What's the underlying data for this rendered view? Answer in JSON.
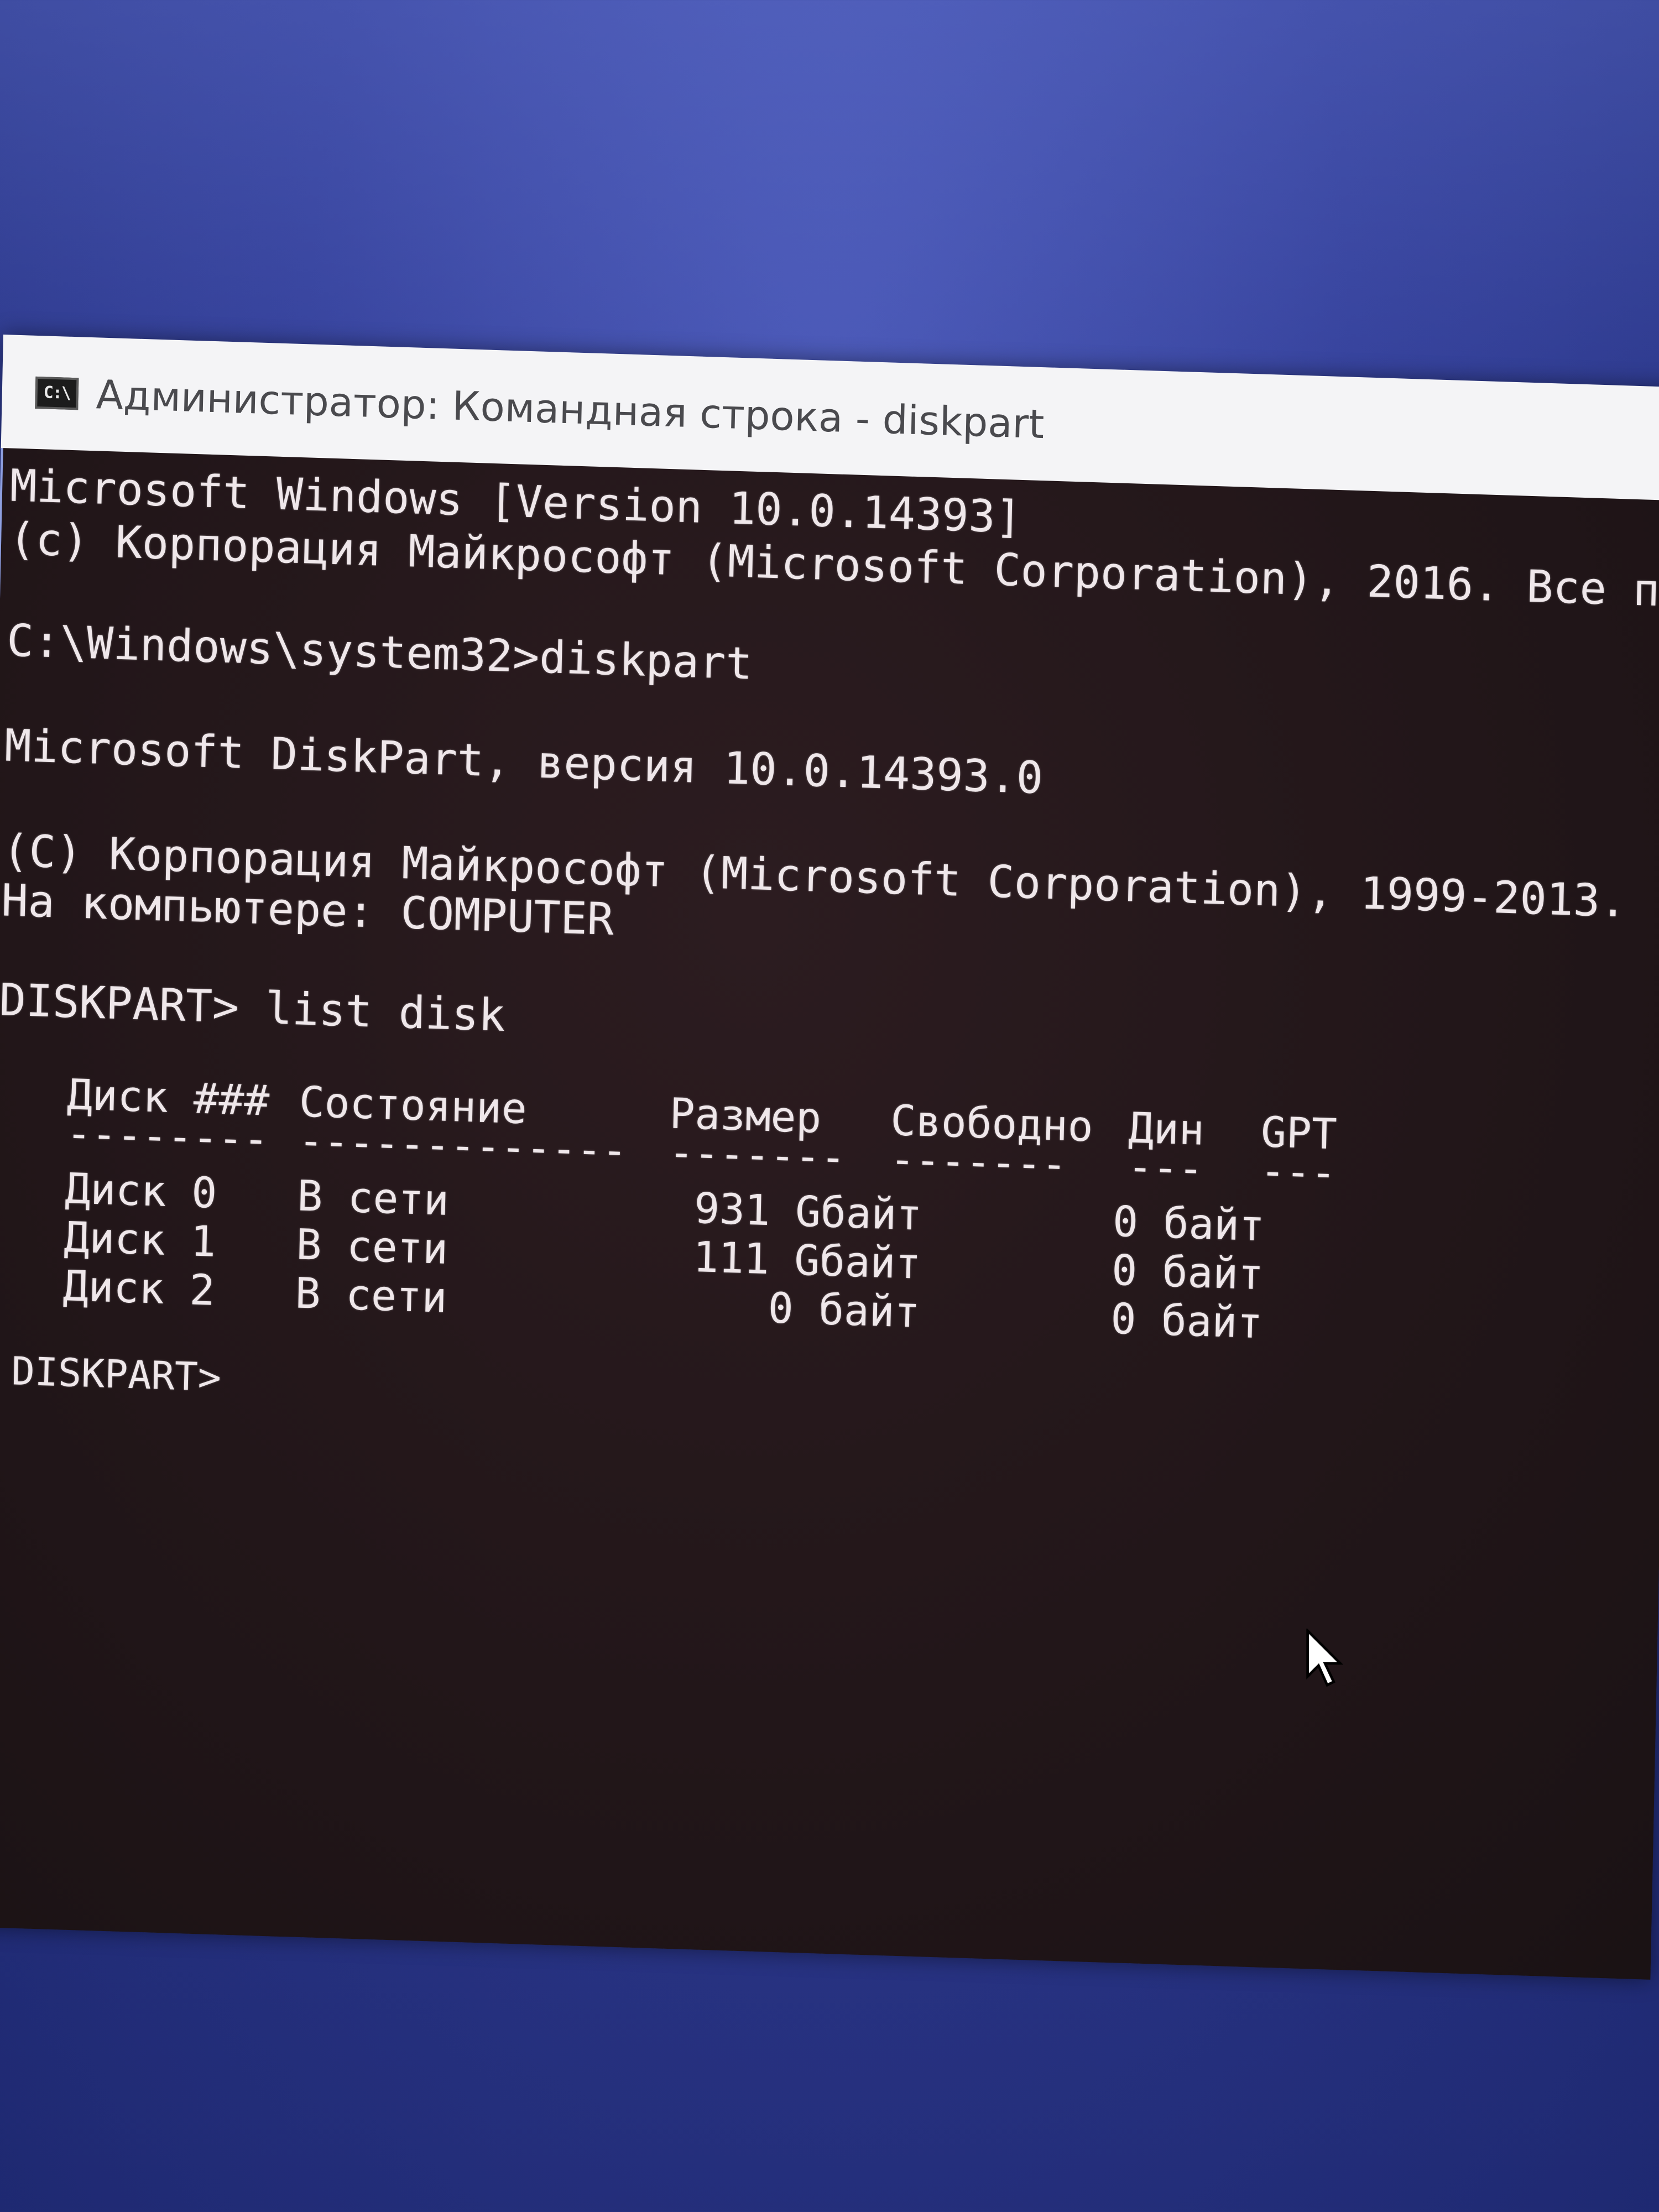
{
  "window": {
    "title": "Администратор: Командная строка - diskpart",
    "icon": "C:\\"
  },
  "console": {
    "lines": [
      "Microsoft Windows [Version 10.0.14393]",
      "(c) Корпорация Майкрософт (Microsoft Corporation), 2016. Все п",
      "C:\\Windows\\system32>diskpart",
      "Microsoft DiskPart, версия 10.0.14393.0",
      "(C) Корпорация Майкрософт (Microsoft Corporation), 1999-2013.",
      "На компьютере: COMPUTER",
      "DISKPART> list disk",
      "DISKPART>"
    ],
    "table": {
      "headers": [
        "Диск ###",
        "Состояние",
        "Размер",
        "Свободно",
        "Дин",
        "GPT"
      ],
      "separators": [
        "--------",
        "-------------",
        "-------",
        "-------",
        "---",
        "---"
      ],
      "rows": [
        [
          "Диск 0",
          "В сети",
          "931 Gбайт",
          "0 байт",
          "",
          ""
        ],
        [
          "Диск 1",
          "В сети",
          "111 Gбайт",
          "0 байт",
          "",
          ""
        ],
        [
          "Диск 2",
          "В сети",
          "0 байт",
          "0 байт",
          "",
          ""
        ]
      ]
    }
  },
  "colors": {
    "desktop": "#34409a",
    "console_bg": "#221619",
    "console_text": "#efe7ea",
    "titlebar": "#f4f4f6"
  },
  "icons": {
    "app_icon": "cmd-icon",
    "pointer": "mouse-pointer-icon"
  }
}
